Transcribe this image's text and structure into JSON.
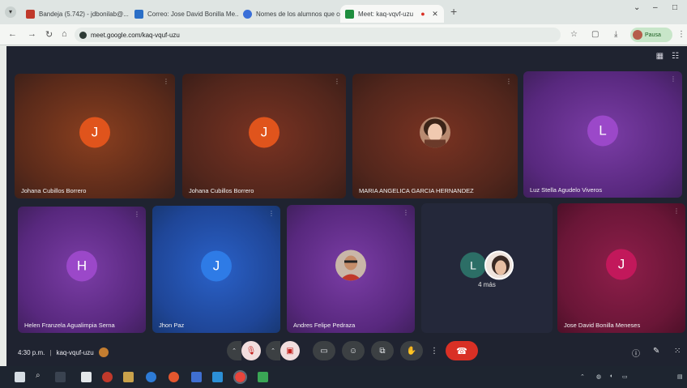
{
  "browser": {
    "tabs": [
      {
        "title": "Bandeja (5.742) - jdbonilab@...",
        "active": false,
        "favicon_color": "#c0392b"
      },
      {
        "title": "Correo: Jose David Bonilla Me...",
        "active": false,
        "favicon_color": "#2b6fc7"
      },
      {
        "title": "Nomes de los alumnos que co...",
        "active": false,
        "favicon_color": "#3a6fd8"
      },
      {
        "title": "Meet: kaq-vqvf-uzu",
        "active": true,
        "favicon_color": "#1e8e3e"
      }
    ],
    "url": "meet.google.com/kaq-vquf-uzu",
    "profile_label": "Pausa"
  },
  "meet": {
    "tiles": [
      {
        "name": "Johana Cubillos Borrero",
        "initial": "J",
        "avatar_color": "#e0541c",
        "style": "t-orange"
      },
      {
        "name": "Johana Cubillos Borrero",
        "initial": "J",
        "avatar_color": "#e0541c",
        "style": "t-brown"
      },
      {
        "name": "MARIA ANGELICA GARCIA HERNANDEZ",
        "initial": "",
        "avatar_color": "",
        "style": "t-brown",
        "photo": true
      },
      {
        "name": "Luz Stella Agudelo Viveros",
        "initial": "L",
        "avatar_color": "#9b48c9",
        "style": "t-purple"
      },
      {
        "name": "Helen Franzela Agualimpia Serna",
        "initial": "H",
        "avatar_color": "#9b48c9",
        "style": "t-purple"
      },
      {
        "name": "Jhon Paz",
        "initial": "J",
        "avatar_color": "#2e7be6",
        "style": "t-blue"
      },
      {
        "name": "Andres Felipe Pedraza",
        "initial": "",
        "avatar_color": "",
        "style": "t-purple",
        "photo": true
      },
      {
        "name": "",
        "initial": "L",
        "avatar_color": "#2c6e66",
        "style": "t-dark",
        "more": "4 más"
      },
      {
        "name": "Jose David Bonilla Meneses",
        "initial": "J",
        "avatar_color": "#c2185b",
        "style": "t-crimson"
      }
    ],
    "time": "4:30 p.m.",
    "meeting_code": "kaq-vquf-uzu"
  },
  "colors": {
    "meet_bg": "#1f2330",
    "end_call": "#d93025",
    "muted_bg": "#f2dede"
  }
}
